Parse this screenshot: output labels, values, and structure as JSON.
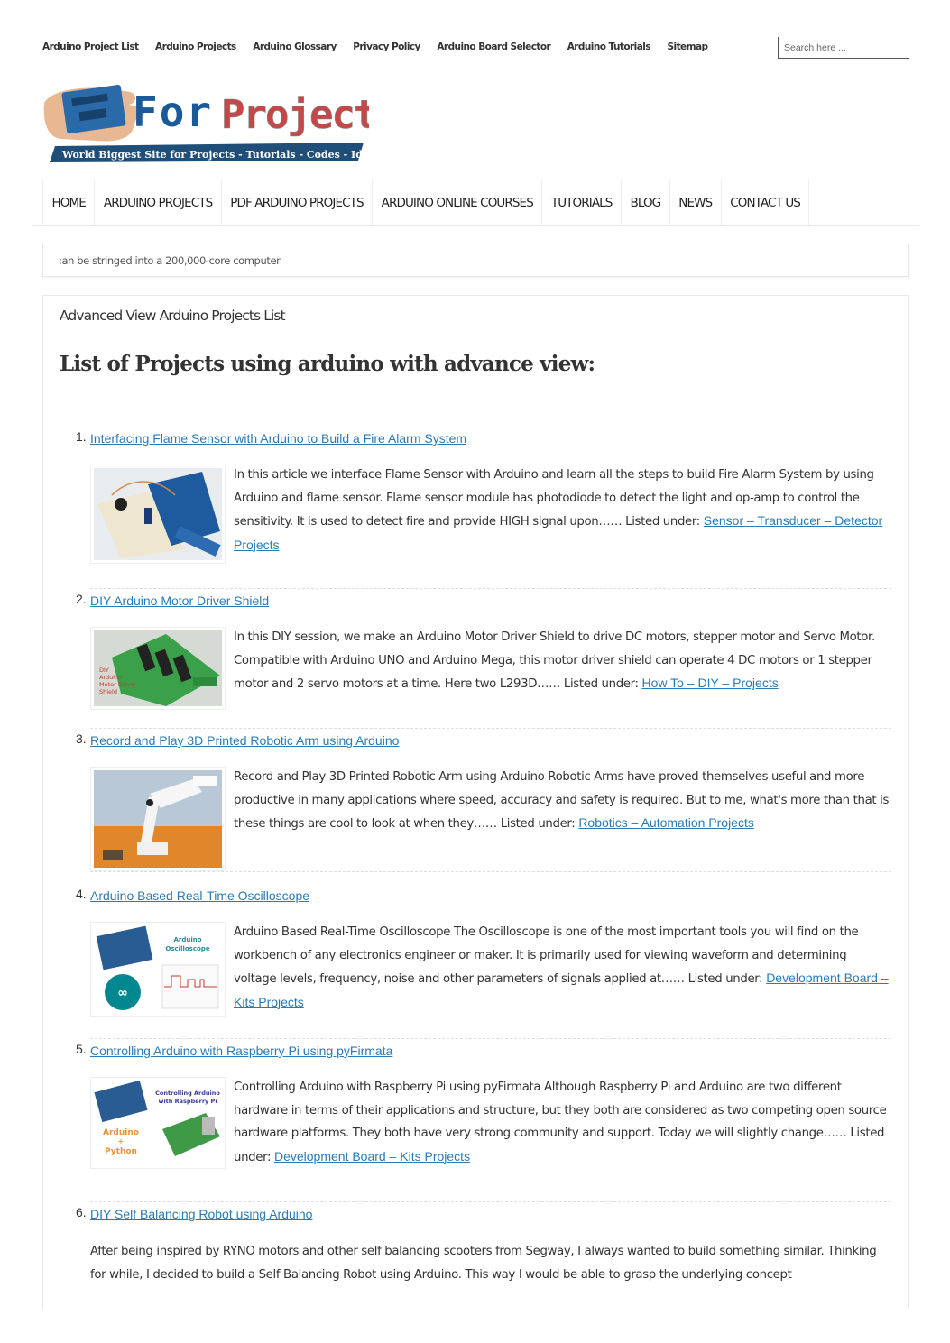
{
  "top_links": [
    "Arduino Project List",
    "Arduino Projects",
    "Arduino Glossary",
    "Privacy Policy",
    "Arduino Board Selector",
    "Arduino Tutorials",
    "Sitemap"
  ],
  "search": {
    "placeholder": "Search here ..."
  },
  "logo": {
    "word1": "For",
    "word2": "Projects",
    "tagline": "World Biggest Site for Projects - Tutorials - Codes - Ideas"
  },
  "main_nav": [
    "HOME",
    "ARDUINO PROJECTS",
    "PDF ARDUINO PROJECTS",
    "ARDUINO ONLINE COURSES",
    "TUTORIALS",
    "BLOG",
    "NEWS",
    "CONTACT US"
  ],
  "ticker": ":an be stringed into a 200,000-core computer",
  "panel": {
    "heading": "Advanced View Arduino Projects List",
    "title": "List of Projects using arduino with advance view:"
  },
  "projects": [
    {
      "num": "1.",
      "title": "Interfacing Flame Sensor with Arduino to Build a Fire Alarm System",
      "text": "In this article we interface Flame Sensor with Arduino and learn all the steps to build Fire Alarm System by using Arduino and flame sensor. Flame sensor module has photodiode to detect the light and op-amp to control the sensitivity. It is used to detect fire and provide HIGH signal upon…… Listed under: ",
      "category": "Sensor – Transducer – Detector Projects",
      "thumb": "breadboard-with-arduino-image"
    },
    {
      "num": "2.",
      "title": "DIY Arduino Motor Driver Shield",
      "text": "In this DIY session, we make an Arduino Motor Driver Shield to drive DC motors, stepper motor and Servo Motor. Compatible with Arduino UNO and Arduino Mega, this motor driver shield can operate 4 DC motors or 1 stepper motor and 2 servo motors at a time. Here two L293D…… Listed under: ",
      "category": "How To – DIY – Projects",
      "thumb": "motor-driver-shield-image",
      "thumb_caption": [
        "DIY",
        "Arduino",
        "Motor Driver",
        "Shield"
      ]
    },
    {
      "num": "3.",
      "title": "Record and Play 3D Printed Robotic Arm using Arduino",
      "text": "Record and Play 3D Printed Robotic Arm using Arduino Robotic Arms have proved themselves useful and more productive in many applications where speed, accuracy and safety is required. But to me, what's more than that is these things are cool to look at when they…… Listed under: ",
      "category": "Robotics – Automation Projects",
      "thumb": "robotic-arm-image"
    },
    {
      "num": "4.",
      "title": "Arduino Based Real-Time Oscilloscope",
      "text": "Arduino Based Real-Time Oscilloscope The Oscilloscope is one of the most important tools you will find on the workbench of any electronics engineer or maker. It is primarily used for viewing waveform and determining voltage levels, frequency, noise and other parameters of signals applied at…… Listed under: ",
      "category": "Development Board – Kits Projects",
      "thumb": "arduino-oscilloscope-image",
      "thumb_caption": [
        "Arduino",
        "Oscilloscope"
      ]
    },
    {
      "num": "5.",
      "title": "Controlling Arduino with Raspberry Pi using pyFirmata",
      "text": "Controlling Arduino with Raspberry Pi using pyFirmata Although Raspberry Pi and Arduino are two different hardware in terms of their applications and structure, but they both are considered as two competing open source hardware platforms. They both have very strong community and support. Today we will slightly change…… Listed under: ",
      "category": "Development Board – Kits Projects",
      "thumb": "arduino-raspberry-pi-image",
      "thumb_caption": [
        "Controlling Arduino",
        "with Raspberry Pi",
        "Arduino",
        "+",
        "Python"
      ]
    },
    {
      "num": "6.",
      "title": "DIY Self Balancing Robot using Arduino",
      "text": "After being inspired by RYNO motors and other self balancing scooters from Segway, I always wanted to build something similar. Thinking for while, I decided to build a Self Balancing Robot using Arduino. This way I would be able to grasp the underlying concept"
    }
  ],
  "colors": {
    "link": "#2a7bb5",
    "logo_blue": "#1a5a9a",
    "logo_red": "#c0392b",
    "tagline_bg": "#1f4e79"
  }
}
